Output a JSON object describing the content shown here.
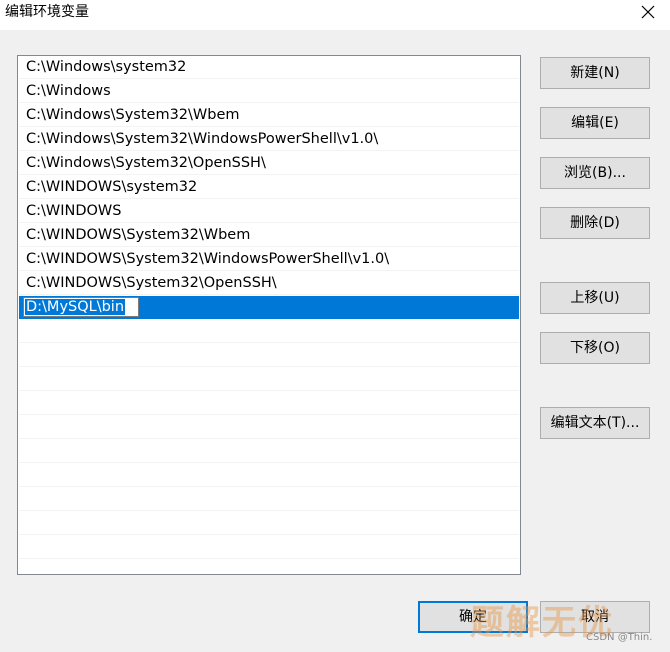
{
  "window": {
    "title": "编辑环境变量"
  },
  "paths": [
    "C:\\Windows\\system32",
    "C:\\Windows",
    "C:\\Windows\\System32\\Wbem",
    "C:\\Windows\\System32\\WindowsPowerShell\\v1.0\\",
    "C:\\Windows\\System32\\OpenSSH\\",
    "C:\\WINDOWS\\system32",
    "C:\\WINDOWS",
    "C:\\WINDOWS\\System32\\Wbem",
    "C:\\WINDOWS\\System32\\WindowsPowerShell\\v1.0\\",
    "C:\\WINDOWS\\System32\\OpenSSH\\"
  ],
  "editing_value": "D:\\MySQL\\bin",
  "buttons": {
    "new": "新建(N)",
    "edit": "编辑(E)",
    "browse": "浏览(B)...",
    "delete": "删除(D)",
    "move_up": "上移(U)",
    "move_down": "下移(O)",
    "edit_text": "编辑文本(T)...",
    "ok": "确定",
    "cancel": "取消"
  },
  "watermark": {
    "main": "题解无优",
    "small": "CSDN @Thin."
  },
  "colors": {
    "selection": "#0078d7",
    "button_face": "#e1e1e1",
    "dialog_bg": "#f0f0f0"
  },
  "icons": {
    "close": "close-icon"
  }
}
